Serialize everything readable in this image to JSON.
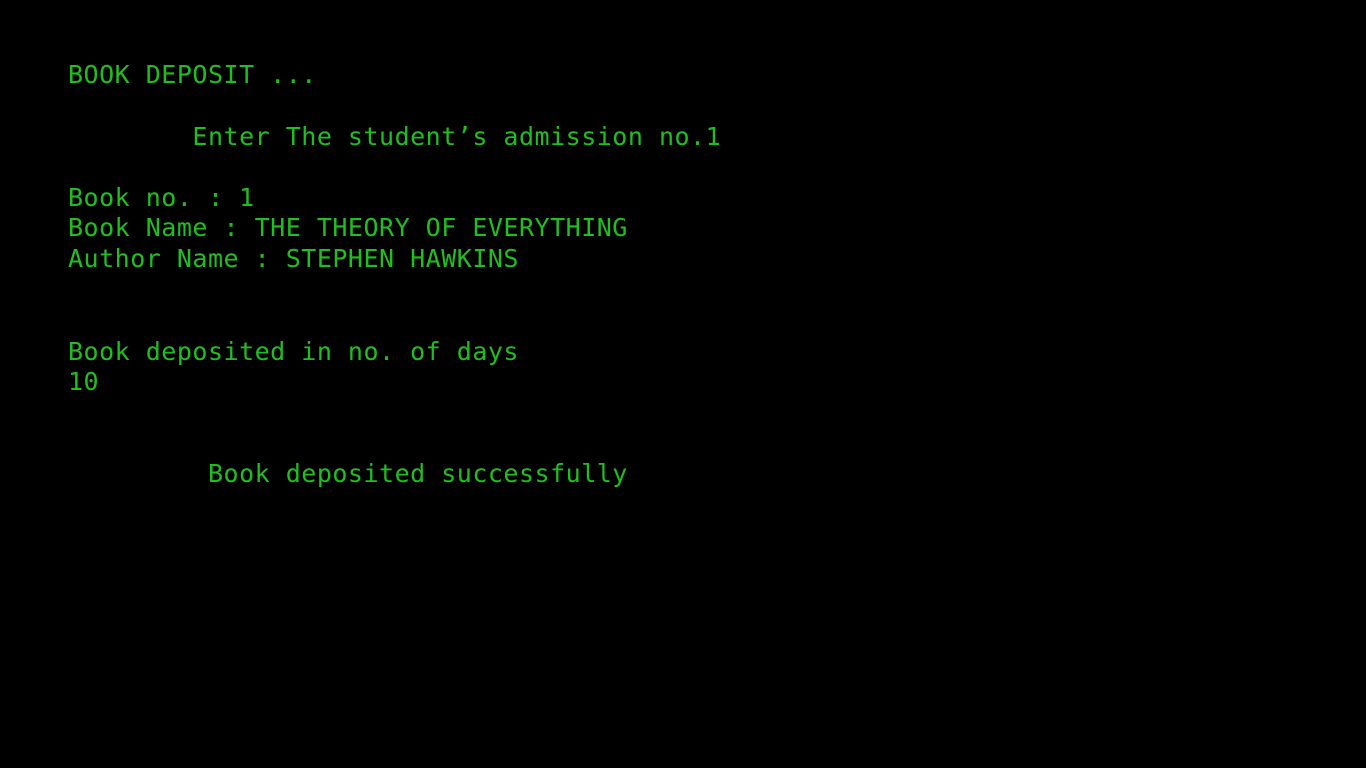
{
  "console": {
    "text_color": "#1fbf1f",
    "background_color": "#000000",
    "title": "BOOK DEPOSIT ...",
    "admission_prompt": "        Enter The student’s admission no.1",
    "book_no_line": "Book no. : 1",
    "book_name_line": "Book Name : THE THEORY OF EVERYTHING",
    "author_name_line": "Author Name : STEPHEN HAWKINS",
    "days_prompt": "Book deposited in no. of days",
    "days_value": "10",
    "success_message": "         Book deposited successfully"
  }
}
